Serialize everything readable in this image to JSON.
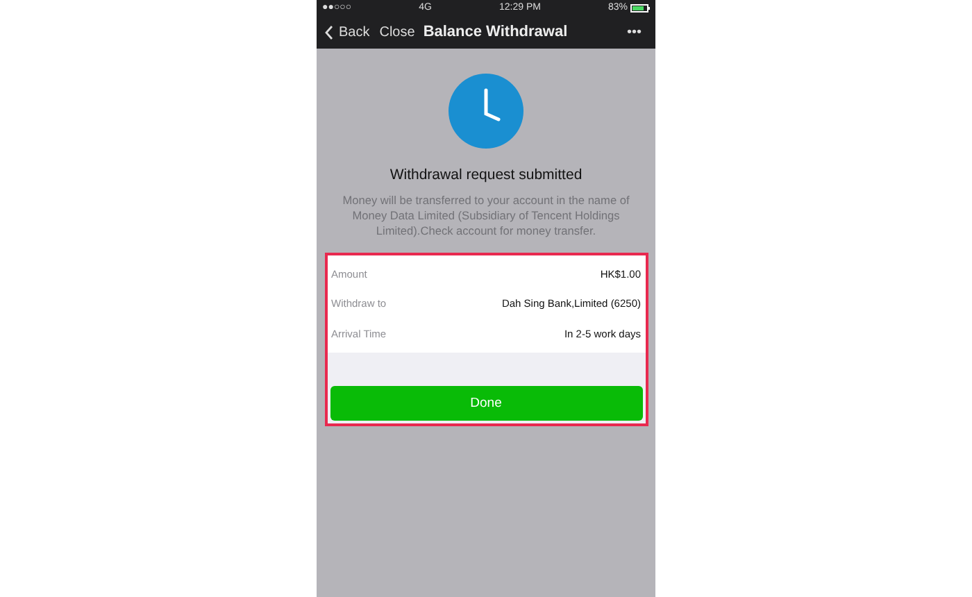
{
  "status_bar": {
    "signal": "●●○○○",
    "network": "4G",
    "time": "12:29 PM",
    "battery": "83%"
  },
  "nav": {
    "back": "Back",
    "close": "Close",
    "title": "Balance Withdrawal",
    "more": "•••"
  },
  "result": {
    "title": "Withdrawal request submitted",
    "message": "Money will be transferred to your account in the name of Money Data Limited (Subsidiary of Tencent Holdings Limited).Check account for money transfer."
  },
  "details": [
    {
      "label": "Amount",
      "value": "HK$1.00"
    },
    {
      "label": "Withdraw to",
      "value": "Dah Sing Bank,Limited (6250)"
    },
    {
      "label": "Arrival Time",
      "value": "In 2-5 work days"
    }
  ],
  "done_button": "Done"
}
